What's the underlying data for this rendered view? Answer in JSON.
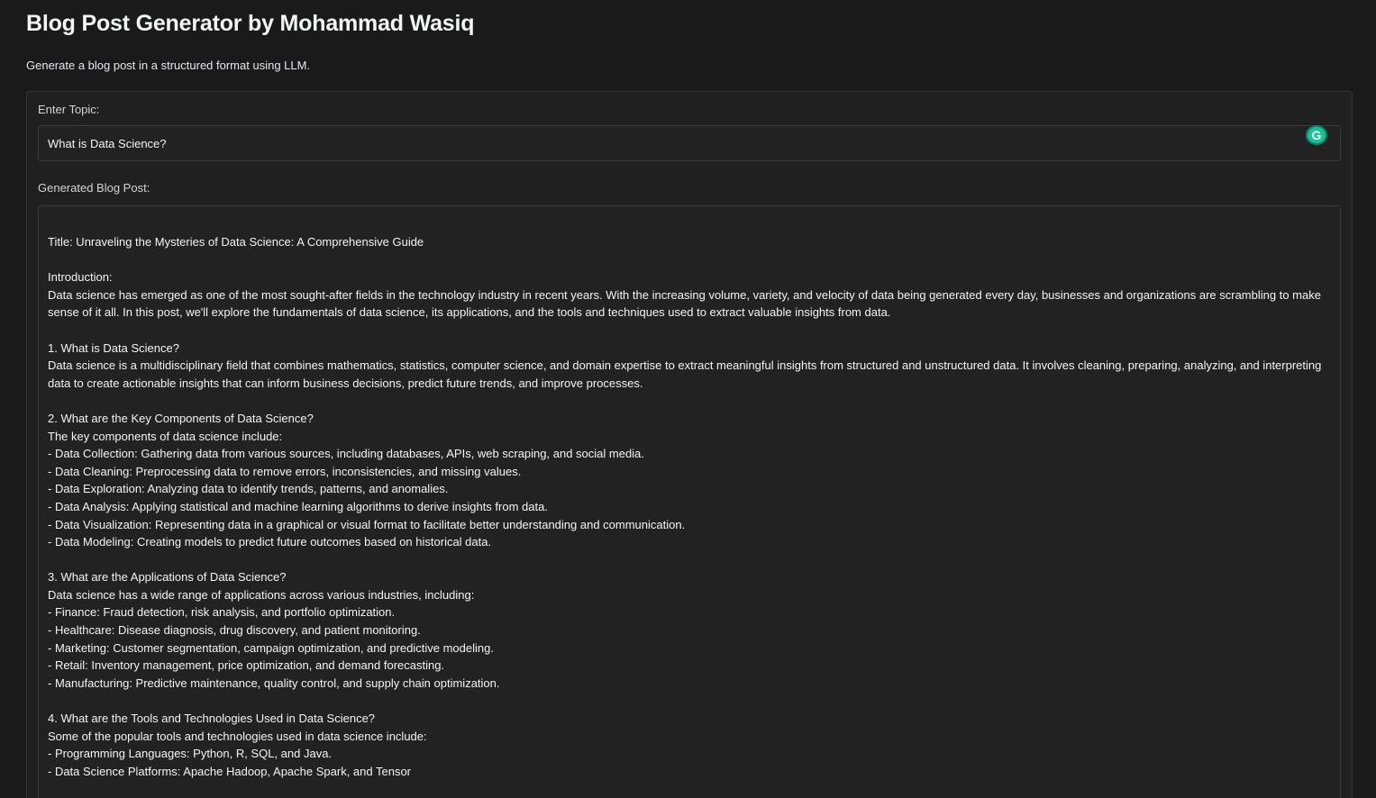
{
  "header": {
    "title": "Blog Post Generator by Mohammad Wasiq",
    "subtitle": "Generate a blog post in a structured format using LLM."
  },
  "topic": {
    "label": "Enter Topic:",
    "value": "What is Data Science?",
    "extension_icon": "grammarly-icon",
    "extension_glyph": "G"
  },
  "output": {
    "label": "Generated Blog Post:",
    "lines": [
      "Title: Unraveling the Mysteries of Data Science: A Comprehensive Guide",
      "",
      "Introduction:",
      "Data science has emerged as one of the most sought-after fields in the technology industry in recent years. With the increasing volume, variety, and velocity of data being generated every day, businesses and organizations are scrambling to make sense of it all. In this post, we'll explore the fundamentals of data science, its applications, and the tools and techniques used to extract valuable insights from data.",
      "",
      "1. What is Data Science?",
      "Data science is a multidisciplinary field that combines mathematics, statistics, computer science, and domain expertise to extract meaningful insights from structured and unstructured data. It involves cleaning, preparing, analyzing, and interpreting data to create actionable insights that can inform business decisions, predict future trends, and improve processes.",
      "",
      "2. What are the Key Components of Data Science?",
      "The key components of data science include:",
      "- Data Collection: Gathering data from various sources, including databases, APIs, web scraping, and social media.",
      "- Data Cleaning: Preprocessing data to remove errors, inconsistencies, and missing values.",
      "- Data Exploration: Analyzing data to identify trends, patterns, and anomalies.",
      "- Data Analysis: Applying statistical and machine learning algorithms to derive insights from data.",
      "- Data Visualization: Representing data in a graphical or visual format to facilitate better understanding and communication.",
      "- Data Modeling: Creating models to predict future outcomes based on historical data.",
      "",
      "3. What are the Applications of Data Science?",
      "Data science has a wide range of applications across various industries, including:",
      "- Finance: Fraud detection, risk analysis, and portfolio optimization.",
      "- Healthcare: Disease diagnosis, drug discovery, and patient monitoring.",
      "- Marketing: Customer segmentation, campaign optimization, and predictive modeling.",
      "- Retail: Inventory management, price optimization, and demand forecasting.",
      "- Manufacturing: Predictive maintenance, quality control, and supply chain optimization.",
      "",
      "4. What are the Tools and Technologies Used in Data Science?",
      "Some of the popular tools and technologies used in data science include:",
      "- Programming Languages: Python, R, SQL, and Java.",
      "- Data Science Platforms: Apache Hadoop, Apache Spark, and Tensor"
    ]
  }
}
